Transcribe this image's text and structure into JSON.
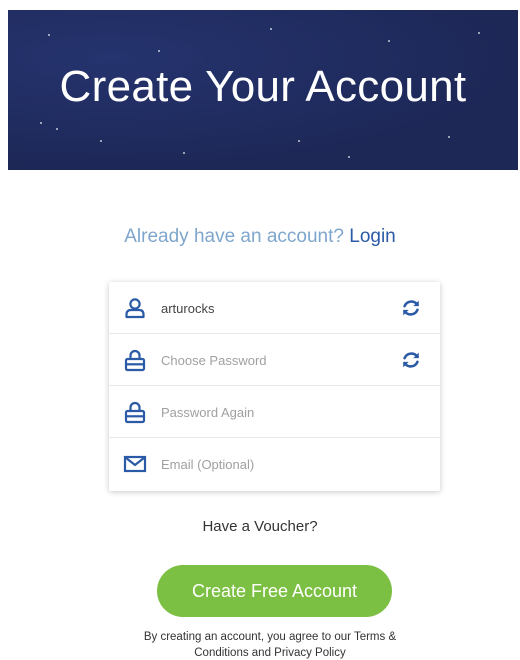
{
  "hero": {
    "title": "Create Your Account",
    "background_color": "#1e2a5e"
  },
  "login_prompt": {
    "text": "Already have an account?",
    "link_label": "Login",
    "text_color": "#7fa6cc",
    "link_color": "#2b5aa6"
  },
  "form": {
    "fields": [
      {
        "icon": "user-icon",
        "value": "arturocks",
        "placeholder": "",
        "has_refresh": true
      },
      {
        "icon": "lock-icon",
        "value": "",
        "placeholder": "Choose Password",
        "has_refresh": true
      },
      {
        "icon": "lock-icon",
        "value": "",
        "placeholder": "Password Again",
        "has_refresh": false
      },
      {
        "icon": "envelope-icon",
        "value": "",
        "placeholder": "Email (Optional)",
        "has_refresh": false
      }
    ],
    "icon_color": "#2b5aa6"
  },
  "voucher": {
    "label": "Have a Voucher?"
  },
  "cta": {
    "label": "Create Free Account",
    "color": "#7cc043"
  },
  "terms": {
    "text": "By creating an account, you agree to our Terms & Conditions and Privacy Policy"
  }
}
